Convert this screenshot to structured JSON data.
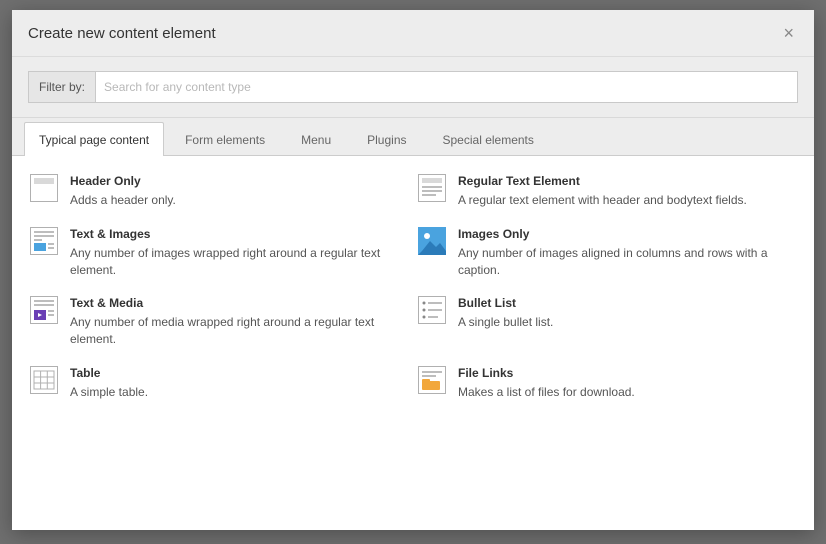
{
  "modal": {
    "title": "Create new content element",
    "close": "×"
  },
  "filter": {
    "label": "Filter by:",
    "placeholder": "Search for any content type"
  },
  "tabs": [
    {
      "label": "Typical page content"
    },
    {
      "label": "Form elements"
    },
    {
      "label": "Menu"
    },
    {
      "label": "Plugins"
    },
    {
      "label": "Special elements"
    }
  ],
  "options": [
    {
      "title": "Header Only",
      "desc": "Adds a header only."
    },
    {
      "title": "Regular Text Element",
      "desc": "A regular text element with header and bodytext fields."
    },
    {
      "title": "Text & Images",
      "desc": "Any number of images wrapped right around a regular text element."
    },
    {
      "title": "Images Only",
      "desc": "Any number of images aligned in columns and rows with a caption."
    },
    {
      "title": "Text & Media",
      "desc": "Any number of media wrapped right around a regular text element."
    },
    {
      "title": "Bullet List",
      "desc": "A single bullet list."
    },
    {
      "title": "Table",
      "desc": "A simple table."
    },
    {
      "title": "File Links",
      "desc": "Makes a list of files for download."
    }
  ]
}
